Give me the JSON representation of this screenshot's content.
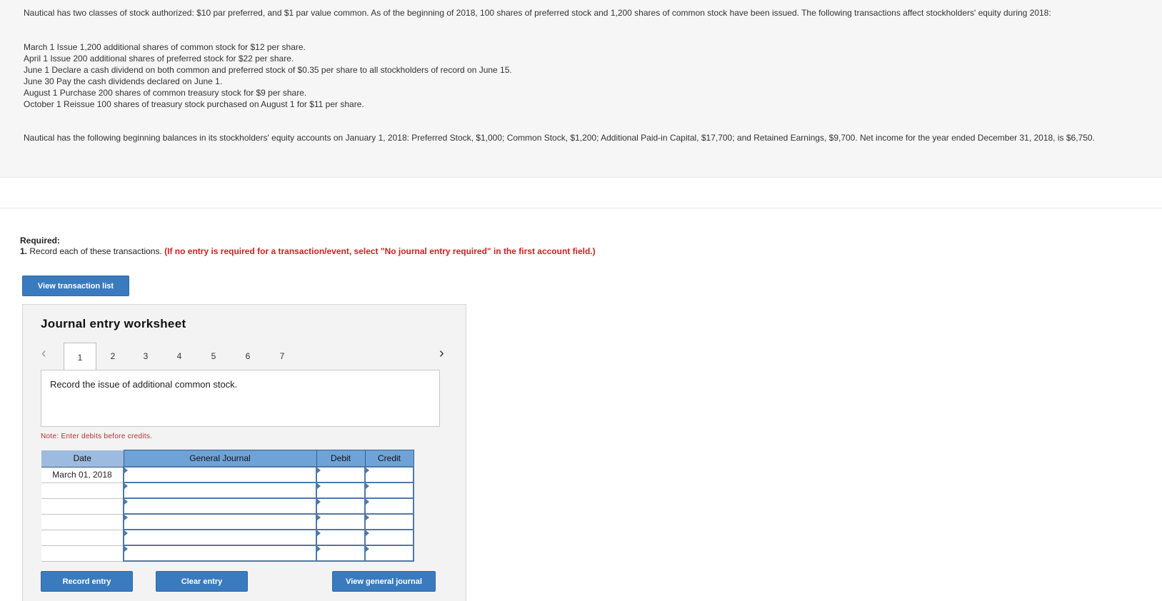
{
  "problem": {
    "intro": "Nautical has two classes of stock authorized: $10 par preferred, and $1 par value common. As of the beginning of 2018, 100 shares of preferred stock and 1,200 shares of common stock have been issued. The following transactions affect stockholders' equity during 2018:",
    "transactions": [
      "March 1 Issue 1,200 additional shares of common stock for $12 per share.",
      "April 1 Issue 200 additional shares of preferred stock for $22 per share.",
      "June 1 Declare a cash dividend on both common and preferred stock of $0.35 per share to all stockholders of record on June 15.",
      "June 30 Pay the cash dividends declared on June 1.",
      "August 1 Purchase 200 shares of common treasury stock for $9 per share.",
      "October 1 Reissue 100 shares of treasury stock purchased on August 1 for $11 per share."
    ],
    "balances": "Nautical has the following beginning balances in its stockholders' equity accounts on January 1, 2018: Preferred Stock, $1,000; Common Stock, $1,200; Additional Paid-in Capital, $17,700; and Retained Earnings, $9,700. Net income for the year ended December 31, 2018, is $6,750."
  },
  "required": {
    "heading": "Required:",
    "number": "1.",
    "text": " Record each of these transactions. ",
    "warning": "(If no entry is required for a transaction/event, select \"No journal entry required\" in the first account field.)"
  },
  "buttons": {
    "view_transaction_list": "View transaction list",
    "record_entry": "Record entry",
    "clear_entry": "Clear entry",
    "view_general_journal": "View general journal"
  },
  "worksheet": {
    "title": "Journal entry worksheet",
    "tabs": [
      "1",
      "2",
      "3",
      "4",
      "5",
      "6",
      "7"
    ],
    "active_tab": "1",
    "description": "Record the issue of additional common stock.",
    "note": "Note: Enter debits before credits.",
    "columns": {
      "date": "Date",
      "journal": "General Journal",
      "debit": "Debit",
      "credit": "Credit"
    },
    "rows": [
      {
        "date": "March 01, 2018"
      },
      {
        "date": ""
      },
      {
        "date": ""
      },
      {
        "date": ""
      },
      {
        "date": ""
      },
      {
        "date": ""
      }
    ]
  },
  "icons": {
    "prev": "chevron-left-icon",
    "next": "chevron-right-icon"
  }
}
